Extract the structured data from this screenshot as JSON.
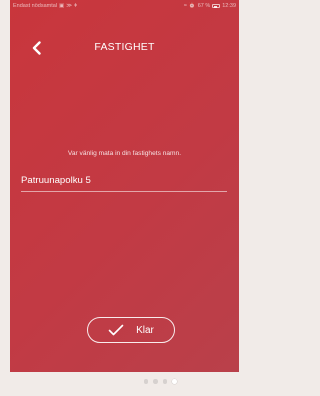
{
  "status_bar": {
    "carrier_text": "Endast nödsamtal",
    "battery_percent": "67 %",
    "battery_level": 0.67,
    "time": "12:39"
  },
  "header": {
    "title": "FASTIGHET"
  },
  "form": {
    "prompt": "Var vänlig mata in din fastighets namn.",
    "property_name_value": "Patruunapolku 5"
  },
  "actions": {
    "done_label": "Klar"
  },
  "pager": {
    "total_pages": 4,
    "current_page": 4
  },
  "colors": {
    "background": "#c5383f",
    "text": "#ffffff"
  }
}
